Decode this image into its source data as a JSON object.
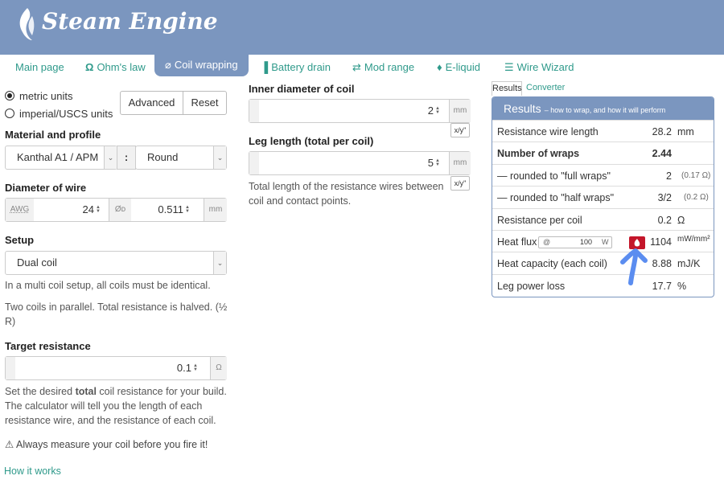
{
  "brand": {
    "name": "Steam Engine"
  },
  "nav": {
    "tabs": [
      {
        "label": "Main page",
        "icon": ""
      },
      {
        "label": "Ohm's law",
        "icon": "omega-icon"
      },
      {
        "label": "Coil wrapping",
        "icon": "paperclip-icon"
      },
      {
        "label": "Battery drain",
        "icon": "bar-chart-icon"
      },
      {
        "label": "Mod range",
        "icon": "exchange-arrows-icon"
      },
      {
        "label": "E-liquid",
        "icon": "droplet-icon"
      },
      {
        "label": "Wire Wizard",
        "icon": "list-icon"
      }
    ],
    "active": "Coil wrapping"
  },
  "units": {
    "metric": "metric units",
    "imperial": "imperial/USCS units",
    "selected": "metric units"
  },
  "buttons": {
    "advanced": "Advanced",
    "reset": "Reset"
  },
  "material": {
    "label": "Material and profile",
    "wire": "Kanthal A1 / APM",
    "separator": ":",
    "profile": "Round"
  },
  "diameter": {
    "label": "Diameter of wire",
    "awg_label": "AWG",
    "awg_value": "24",
    "dia_symbol": "Øᴅ",
    "dia_value": "0.511",
    "unit": "mm"
  },
  "setup": {
    "label": "Setup",
    "value": "Dual coil",
    "note1": "In a multi coil setup, all coils must be identical.",
    "note2": "Two coils in parallel. Total resistance is halved. (½ R)"
  },
  "target": {
    "label": "Target resistance",
    "value": "0.1",
    "unit": "Ω",
    "desc_pre": "Set the desired ",
    "desc_bold": "total",
    "desc_post": " coil resistance for your build. The calculator will tell you the length of each resistance wire, and the resistance of each coil."
  },
  "warning": {
    "icon": "warning-icon",
    "text": "Always measure your coil before you fire it!"
  },
  "how_it_works": "How it works",
  "inner": {
    "label": "Inner diameter of coil",
    "value": "2",
    "unit": "mm",
    "ratio": "x/y\""
  },
  "leg": {
    "label": "Leg length (total per coil)",
    "value": "5",
    "unit": "mm",
    "ratio": "x/y\"",
    "note": "Total length of the resistance wires between coil and contact points."
  },
  "results": {
    "tabs": [
      "Results",
      "Converter"
    ],
    "title": "Results",
    "subtitle": "– how to wrap, and how it will perform",
    "rows": [
      {
        "key": "Resistance wire length",
        "value": "28.2",
        "unit": "mm",
        "extra": ""
      },
      {
        "key": "Number of wraps",
        "value": "2.44",
        "unit": "",
        "extra": ""
      },
      {
        "key": "— rounded to \"full wraps\"",
        "value": "2",
        "unit": "",
        "extra": "(0.17 Ω)"
      },
      {
        "key": "— rounded to \"half wraps\"",
        "value": "3/2",
        "unit": "",
        "extra": "(0.2 Ω)"
      },
      {
        "key": "Resistance per coil",
        "value": "0.2",
        "unit": "Ω",
        "extra": ""
      },
      {
        "key": "Heat flux",
        "value": "1104",
        "unit": "mW/mm²",
        "extra": "",
        "at": "@",
        "watts": "100",
        "w": "W"
      },
      {
        "key": "Heat capacity (each coil)",
        "value": "8.88",
        "unit": "mJ/K",
        "extra": ""
      },
      {
        "key": "Leg power loss",
        "value": "17.7",
        "unit": "%",
        "extra": ""
      }
    ]
  },
  "colors": {
    "accent": "#7b96bf",
    "link": "#2f9a8b",
    "fire": "#c4162a",
    "annotation": "#5b8df0"
  }
}
